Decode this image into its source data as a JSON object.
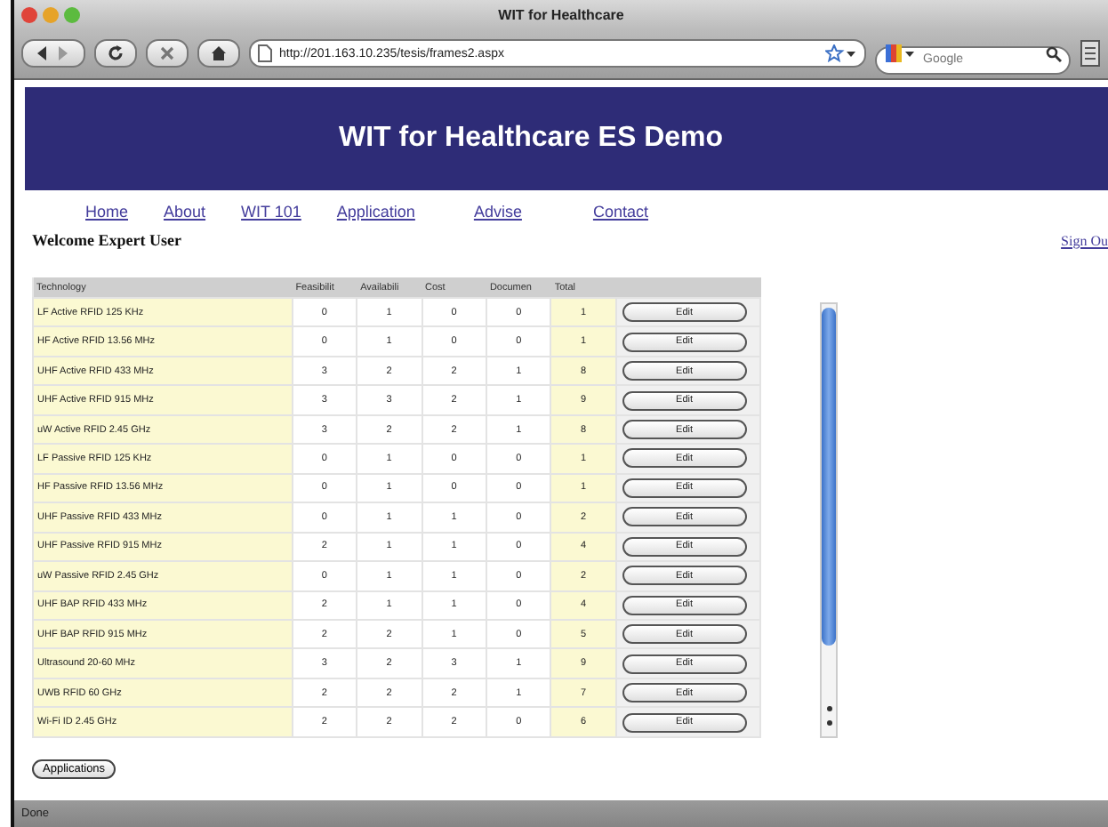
{
  "window": {
    "title": "WIT for Healthcare"
  },
  "toolbar": {
    "url": "http://201.163.10.235/tesis/frames2.aspx",
    "search": {
      "placeholder": "Google"
    }
  },
  "header": {
    "title": "WIT for Healthcare ES Demo"
  },
  "nav": [
    "Home",
    "About",
    "WIT 101",
    "Application",
    "Advise",
    "Contact"
  ],
  "welcome": "Welcome Expert User",
  "sign_out": "Sign Ou",
  "table": {
    "columns": [
      "Technology",
      "Feasibilit",
      "Availabili",
      "Cost",
      "Documen",
      "Total"
    ],
    "rows": [
      {
        "technology": "LF Active RFID 125 KHz",
        "values": [
          "0",
          "1",
          "0",
          "0"
        ],
        "total": "1",
        "action": "Edit"
      },
      {
        "technology": "HF Active RFID 13.56 MHz",
        "values": [
          "0",
          "1",
          "0",
          "0"
        ],
        "total": "1",
        "action": "Edit"
      },
      {
        "technology": "UHF Active RFID 433 MHz",
        "values": [
          "3",
          "2",
          "2",
          "1"
        ],
        "total": "8",
        "action": "Edit"
      },
      {
        "technology": "UHF Active RFID 915 MHz",
        "values": [
          "3",
          "3",
          "2",
          "1"
        ],
        "total": "9",
        "action": "Edit"
      },
      {
        "technology": "uW Active RFID 2.45 GHz",
        "values": [
          "3",
          "2",
          "2",
          "1"
        ],
        "total": "8",
        "action": "Edit"
      },
      {
        "technology": "LF Passive RFID 125 KHz",
        "values": [
          "0",
          "1",
          "0",
          "0"
        ],
        "total": "1",
        "action": "Edit"
      },
      {
        "technology": "HF Passive RFID 13.56 MHz",
        "values": [
          "0",
          "1",
          "0",
          "0"
        ],
        "total": "1",
        "action": "Edit"
      },
      {
        "technology": "UHF Passive RFID 433 MHz",
        "values": [
          "0",
          "1",
          "1",
          "0"
        ],
        "total": "2",
        "action": "Edit"
      },
      {
        "technology": "UHF Passive RFID 915 MHz",
        "values": [
          "2",
          "1",
          "1",
          "0"
        ],
        "total": "4",
        "action": "Edit"
      },
      {
        "technology": "uW Passive RFID 2.45 GHz",
        "values": [
          "0",
          "1",
          "1",
          "0"
        ],
        "total": "2",
        "action": "Edit"
      },
      {
        "technology": "UHF BAP RFID 433 MHz",
        "values": [
          "2",
          "1",
          "1",
          "0"
        ],
        "total": "4",
        "action": "Edit"
      },
      {
        "technology": "UHF BAP RFID 915 MHz",
        "values": [
          "2",
          "2",
          "1",
          "0"
        ],
        "total": "5",
        "action": "Edit"
      },
      {
        "technology": "Ultrasound 20-60 MHz",
        "values": [
          "3",
          "2",
          "3",
          "1"
        ],
        "total": "9",
        "action": "Edit"
      },
      {
        "technology": "UWB RFID 60 GHz",
        "values": [
          "2",
          "2",
          "2",
          "1"
        ],
        "total": "7",
        "action": "Edit"
      },
      {
        "technology": "Wi-Fi ID 2.45 GHz",
        "values": [
          "2",
          "2",
          "2",
          "0"
        ],
        "total": "6",
        "action": "Edit"
      }
    ]
  },
  "applications_button": "Applications",
  "status_bar": "Done"
}
